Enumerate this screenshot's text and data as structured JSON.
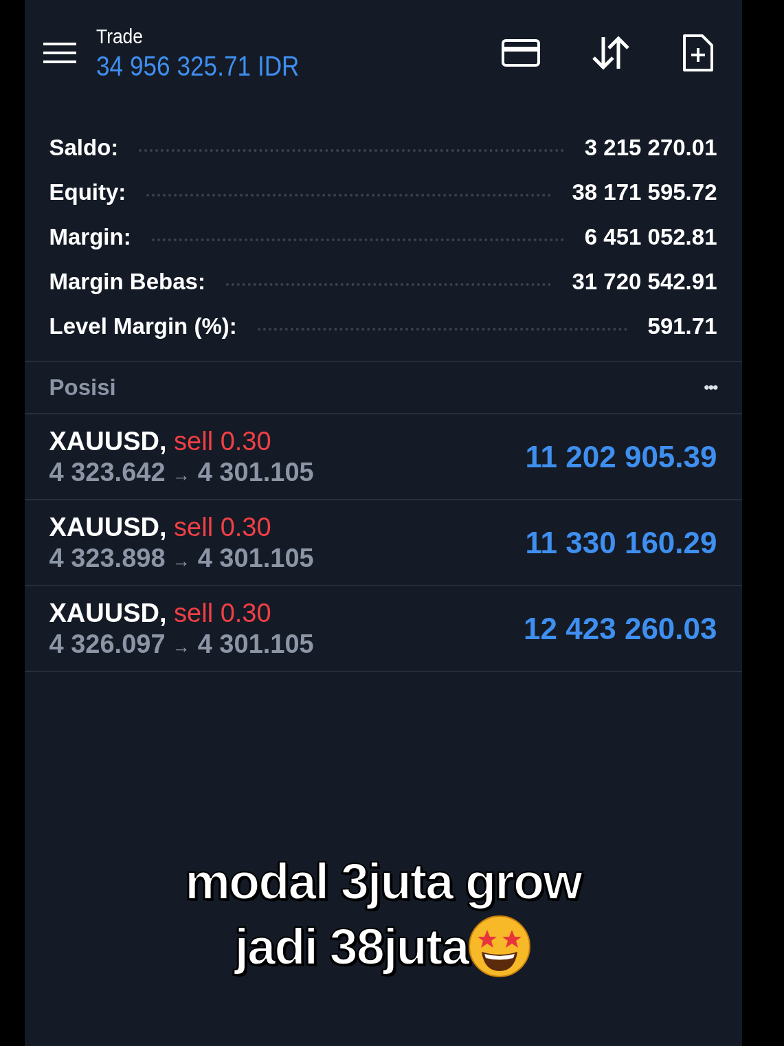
{
  "header": {
    "title": "Trade",
    "balance": "34 956 325.71 IDR"
  },
  "summary": [
    {
      "label": "Saldo:",
      "value": "3 215 270.01"
    },
    {
      "label": "Equity:",
      "value": "38 171 595.72"
    },
    {
      "label": "Margin:",
      "value": "6 451 052.81"
    },
    {
      "label": "Margin Bebas:",
      "value": "31 720 542.91"
    },
    {
      "label": "Level Margin (%):",
      "value": "591.71"
    }
  ],
  "positions": {
    "title": "Posisi",
    "more": "•••",
    "rows": [
      {
        "symbol": "XAUUSD,",
        "side": "sell 0.30",
        "open": "4 323.642",
        "arrow": "→",
        "current": "4 301.105",
        "profit": "11 202 905.39"
      },
      {
        "symbol": "XAUUSD,",
        "side": "sell 0.30",
        "open": "4 323.898",
        "arrow": "→",
        "current": "4 301.105",
        "profit": "11 330 160.29"
      },
      {
        "symbol": "XAUUSD,",
        "side": "sell 0.30",
        "open": "4 326.097",
        "arrow": "→",
        "current": "4 301.105",
        "profit": "12 423 260.03"
      }
    ]
  },
  "caption": [
    "modal 3juta grow",
    "jadi 38juta"
  ]
}
